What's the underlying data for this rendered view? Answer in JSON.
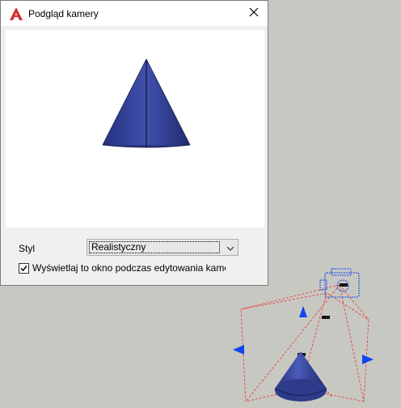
{
  "dialog": {
    "title": "Podgląd kamery",
    "app_icon": "autocad-icon",
    "close_icon": "close-icon",
    "style_label": "Styl",
    "style_value": "Realistyczny",
    "checkbox_label": "Wyświetlaj to okno podczas edytowania kame",
    "checkbox_checked": true
  },
  "colors": {
    "cone": "#3b4a9a",
    "camera_lines": "#e8322d",
    "grips": "#1144ee",
    "background": "#c8c8c3"
  }
}
